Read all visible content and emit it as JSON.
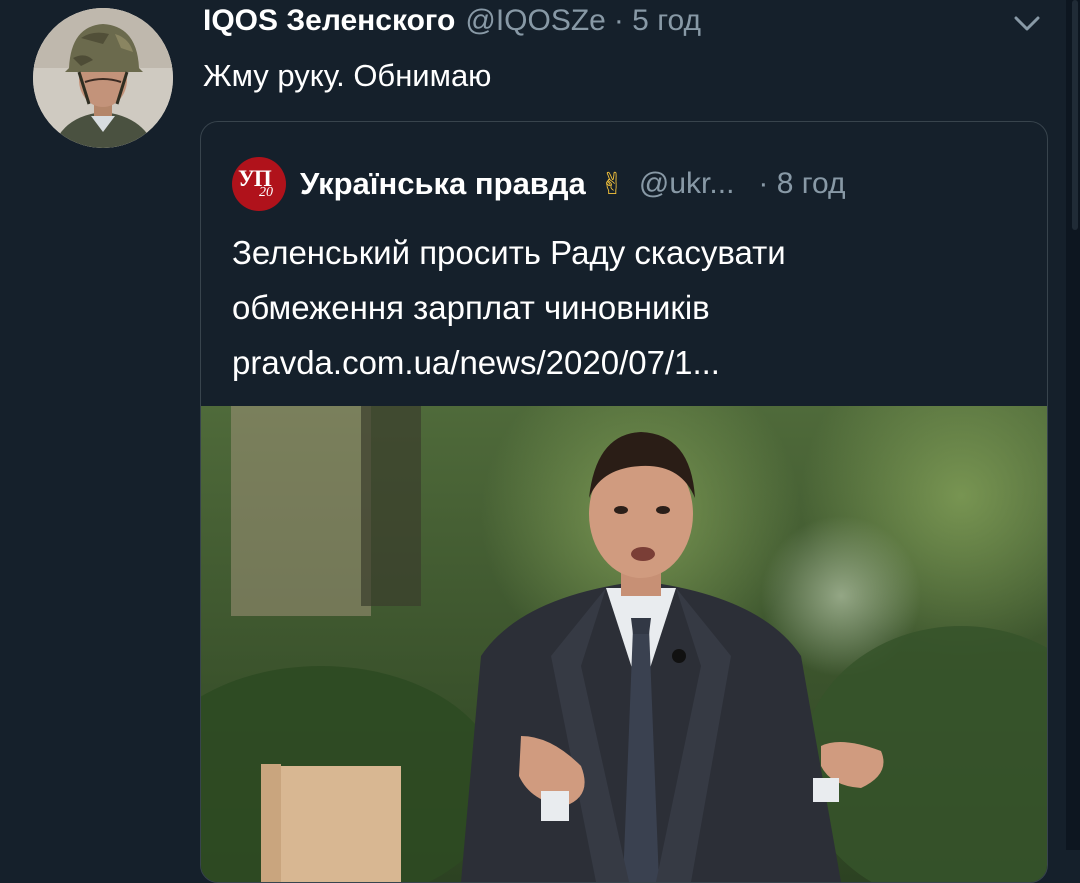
{
  "tweet": {
    "author_name": "IQOS Зеленского",
    "author_handle": "@IQOSZe",
    "time": "· 5 год",
    "text": "Жму руку. Обнимаю",
    "avatar_icon": "user-avatar-helmet",
    "menu_icon": "chevron-down-icon"
  },
  "quoted": {
    "logo_text": "УП",
    "logo_sub": "20",
    "author_name": "Українська правда",
    "emoji": "✌",
    "author_handle": "@ukr...",
    "time": "· 8 год",
    "text_lines": [
      "Зеленський просить Раду скасувати",
      "обмеження зарплат чиновників",
      "pravda.com.ua/news/2020/07/1..."
    ]
  },
  "colors": {
    "background": "#15202b",
    "border": "#38444d",
    "secondary_text": "#8899a6",
    "logo_red": "#b0121b"
  }
}
